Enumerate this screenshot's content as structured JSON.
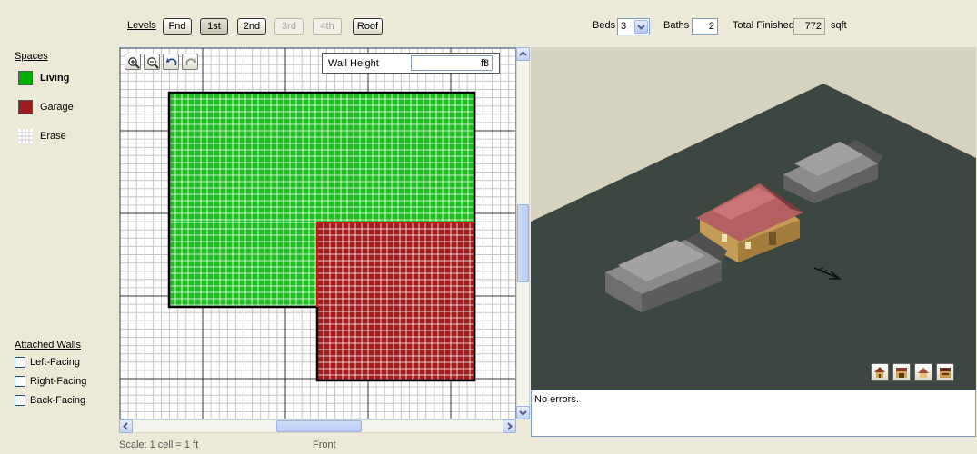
{
  "levels": {
    "label": "Levels",
    "buttons": [
      {
        "label": "Fnd",
        "state": "normal"
      },
      {
        "label": "1st",
        "state": "active"
      },
      {
        "label": "2nd",
        "state": "normal"
      },
      {
        "label": "3rd",
        "state": "disabled"
      },
      {
        "label": "4th",
        "state": "disabled"
      },
      {
        "label": "Roof",
        "state": "normal"
      }
    ]
  },
  "summary": {
    "beds_label": "Beds",
    "beds_value": "3",
    "baths_label": "Baths",
    "baths_value": "2",
    "total_label": "Total Finished",
    "total_value": "772",
    "total_unit": "sqft"
  },
  "spaces": {
    "title": "Spaces",
    "items": [
      {
        "label": "Living",
        "color": "#00b000",
        "selected": true
      },
      {
        "label": "Garage",
        "color": "#9a1c1c",
        "selected": false
      },
      {
        "label": "Erase",
        "color": "#ffffff",
        "selected": false
      }
    ]
  },
  "attached_walls": {
    "title": "Attached Walls",
    "items": [
      {
        "label": "Left-Facing",
        "checked": false
      },
      {
        "label": "Right-Facing",
        "checked": false
      },
      {
        "label": "Back-Facing",
        "checked": false
      }
    ]
  },
  "canvas": {
    "tools": [
      "zoom-in-icon",
      "zoom-out-icon",
      "undo-icon",
      "redo-icon"
    ],
    "wall_height_label": "Wall Height",
    "wall_height_value": "8",
    "wall_height_unit": "ft",
    "living_color": "#1ebe1e",
    "garage_color": "#a51e1e"
  },
  "footer": {
    "scale": "Scale: 1 cell = 1 ft",
    "view": "Front"
  },
  "view3d": {
    "buttons": [
      "house-view-icon",
      "garage-view-icon",
      "front-view-icon",
      "side-view-icon"
    ]
  },
  "status": {
    "message": "No errors."
  }
}
